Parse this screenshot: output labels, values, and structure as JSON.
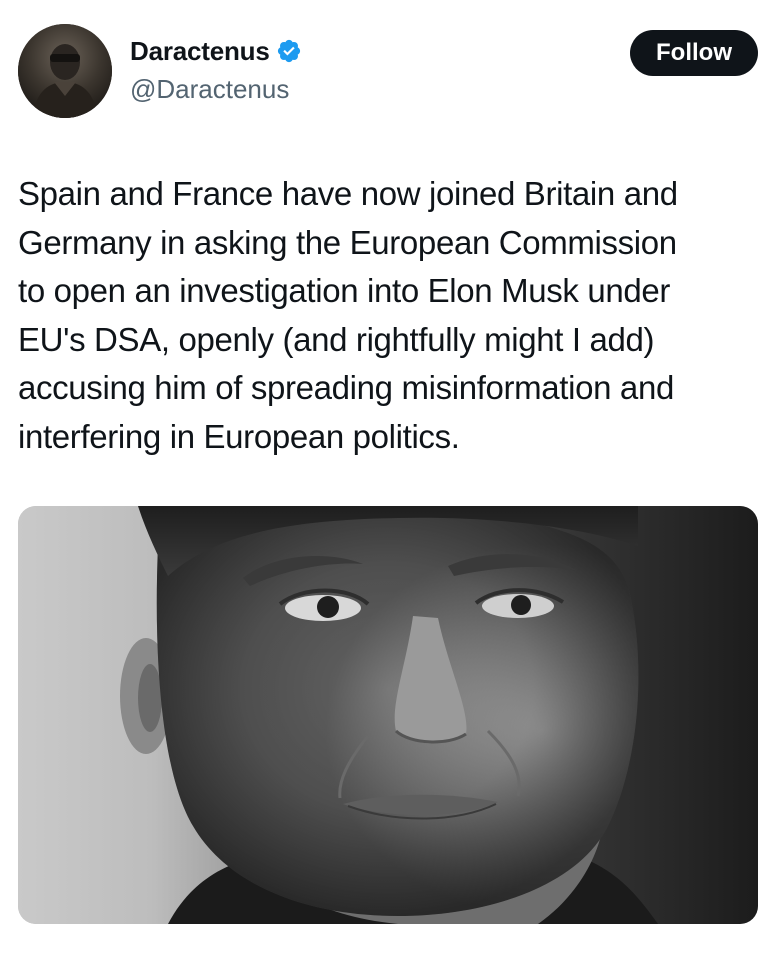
{
  "author": {
    "display_name": "Daractenus",
    "handle": "@Daractenus",
    "verified": true,
    "avatar_icon": "profile-avatar"
  },
  "actions": {
    "follow_label": "Follow"
  },
  "tweet": {
    "text": "Spain and France have now joined Britain and\nGermany in asking the European Commission\nto open an investigation into Elon Musk under\nEU's DSA, openly (and rightfully might I add)\naccusing him of spreading misinformation and\ninterfering in European politics."
  },
  "media": {
    "type": "photo",
    "style": "black-and-white portrait"
  },
  "colors": {
    "text_primary": "#0f1419",
    "text_secondary": "#536471",
    "verified_blue": "#1d9bf0",
    "follow_bg": "#0f1419",
    "follow_text": "#ffffff"
  }
}
